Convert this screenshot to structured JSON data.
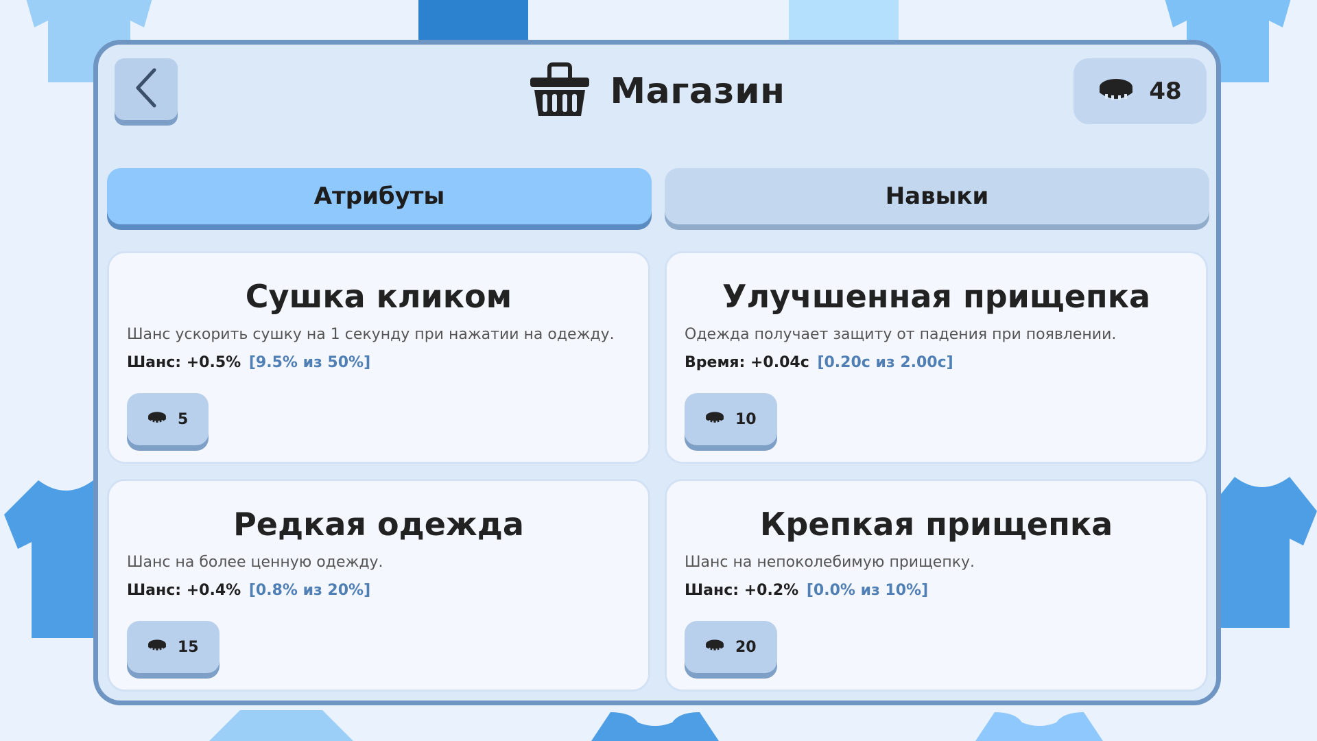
{
  "header": {
    "title": "Магазин",
    "coins": "48",
    "back_icon": "chevron-left-icon",
    "basket_icon": "basket-icon",
    "coin_icon": "coin-icon"
  },
  "tabs": [
    {
      "label": "Атрибуты",
      "active": true
    },
    {
      "label": "Навыки",
      "active": false
    }
  ],
  "cards": [
    {
      "title": "Сушка кликом",
      "description": "Шанс ускорить сушку на 1 секунду при нажатии на одежду.",
      "stat_label": "Шанс: +0.5%",
      "stat_progress": "[9.5% из 50%]",
      "price": "5"
    },
    {
      "title": "Улучшенная прищепка",
      "description": "Одежда получает защиту от падения при появлении.",
      "stat_label": "Время: +0.04с",
      "stat_progress": "[0.20с из 2.00с]",
      "price": "10"
    },
    {
      "title": "Редкая одежда",
      "description": "Шанс на более ценную одежду.",
      "stat_label": "Шанс: +0.4%",
      "stat_progress": "[0.8% из 20%]",
      "price": "15"
    },
    {
      "title": "Крепкая прищепка",
      "description": "Шанс на непоколебимую прищепку.",
      "stat_label": "Шанс: +0.2%",
      "stat_progress": "[0.0% из 10%]",
      "price": "20"
    }
  ],
  "colors": {
    "panel_bg": "#dce9f9",
    "panel_border": "#6f95c2",
    "tab_active": "#8ec8fc",
    "tab_inactive": "#c3d8ee",
    "progress_text": "#4f7fb4"
  }
}
